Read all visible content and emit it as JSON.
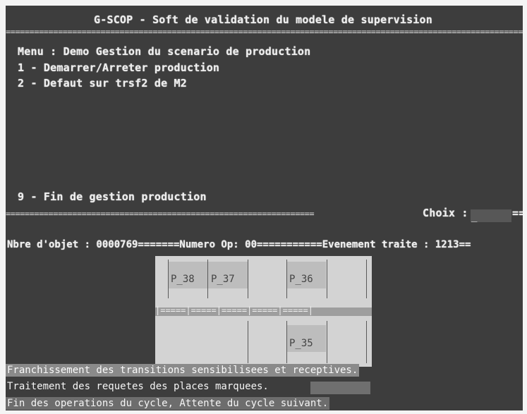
{
  "title": "G-SCOP - Soft de validation du modele de supervision",
  "separator": "==================================================================================================================",
  "menu": {
    "heading": "Menu : Demo Gestion du scenario de production",
    "items": [
      {
        "label": "1 - Demarrer/Arreter production"
      },
      {
        "label": "2 - Defaut sur trsf2 de M2"
      },
      {
        "label": "9 - Fin de gestion production"
      }
    ]
  },
  "prompt": {
    "bar": "=================================================================",
    "label": "Choix :",
    "tail": "==",
    "cursor": "_"
  },
  "info_line": "Nbre d'objet : 0000769=======Numero Op: 00===========Evenement traite : 1213==",
  "places": {
    "p38": "P_38",
    "p37": "P_37",
    "p36": "P_36",
    "p35": "P_35",
    "conveyor": "|=====|=====|=====|=====|=====|"
  },
  "status": {
    "line1": "Franchissement des transitions sensibilisees et receptives.",
    "line2": "Traitement des requetes des places marquees.",
    "line3": "Fin des operations du cycle, Attente du cycle suivant."
  }
}
